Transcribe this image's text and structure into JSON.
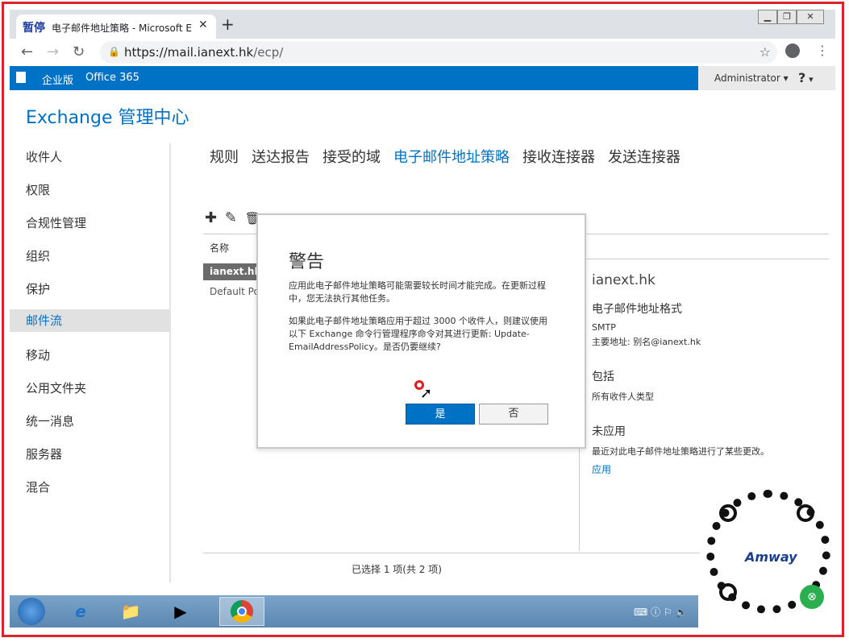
{
  "browser": {
    "paused_badge": "暂停",
    "tab_title": "电子邮件地址策略 - Microsoft E",
    "url_host": "https://mail.ianext.hk",
    "url_path": "/ecp/"
  },
  "o365": {
    "edition": "企业版",
    "product": "Office 365",
    "user": "Administrator",
    "help": "?"
  },
  "eac": {
    "title": "Exchange 管理中心",
    "sidebar": [
      "收件人",
      "权限",
      "合规性管理",
      "组织",
      "保护",
      "邮件流",
      "移动",
      "公用文件夹",
      "统一消息",
      "服务器",
      "混合"
    ],
    "active_sidebar_index": 5,
    "subnav": [
      "规则",
      "送达报告",
      "接受的域",
      "电子邮件地址策略",
      "接收连接器",
      "发送连接器"
    ],
    "active_subnav_index": 3,
    "column_name": "名称",
    "rows": [
      "ianext.hk",
      "Default Policy"
    ],
    "status": "已选择 1 项(共 2 项)"
  },
  "details": {
    "domain": "ianext.hk",
    "format_heading": "电子邮件地址格式",
    "format_type": "SMTP",
    "format_primary": "主要地址: 别名@ianext.hk",
    "includes_heading": "包括",
    "includes_value": "所有收件人类型",
    "not_applied_heading": "未应用",
    "not_applied_text": "最近对此电子邮件地址策略进行了某些更改。",
    "apply_link": "应用"
  },
  "dialog": {
    "title": "警告",
    "para1": "应用此电子邮件地址策略可能需要较长时间才能完成。在更新过程中，您无法执行其他任务。",
    "para2": "如果此电子邮件地址策略应用于超过 3000 个收件人，则建议使用以下 Exchange 命令行管理程序命令对其进行更新: Update-EmailAddressPolicy。是否仍要继续?",
    "yes": "是",
    "no": "否"
  },
  "qr": {
    "brand": "Amway"
  }
}
